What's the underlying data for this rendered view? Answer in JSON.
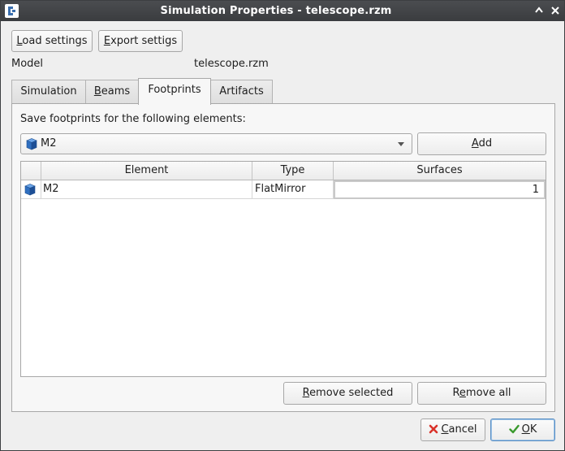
{
  "window": {
    "title": "Simulation Properties - telescope.rzm",
    "restore_glyph": "🡩",
    "close_glyph": "✕"
  },
  "toolbar": {
    "load_settings": {
      "pre": "",
      "mnemonic": "L",
      "post": "oad settings"
    },
    "export_settings": {
      "pre": "",
      "mnemonic": "E",
      "post": "xport settigs"
    }
  },
  "model": {
    "label": "Model",
    "value": "telescope.rzm"
  },
  "tabs": [
    {
      "label": "Simulation",
      "mnemonic_index": -1,
      "active": false
    },
    {
      "pre": "",
      "mnemonic": "B",
      "post": "eams",
      "active": false
    },
    {
      "label": "Footprints",
      "active": true
    },
    {
      "label": "Artifacts",
      "active": false
    }
  ],
  "footprints": {
    "heading": "Save footprints for the following elements:",
    "selected_element": "M2",
    "add_button": {
      "pre": "",
      "mnemonic": "A",
      "post": "dd"
    },
    "table": {
      "headers": [
        "",
        "Element",
        "Type",
        "Surfaces"
      ],
      "rows": [
        {
          "icon": "cube-icon",
          "element": "M2",
          "type": "FlatMirror",
          "surfaces": "1"
        }
      ]
    },
    "remove_selected": {
      "pre": "",
      "mnemonic": "R",
      "post": "emove selected"
    },
    "remove_all": {
      "pre": "R",
      "mnemonic": "e",
      "post": "move all"
    }
  },
  "dialog_buttons": {
    "cancel": {
      "pre": "",
      "mnemonic": "C",
      "post": "ancel"
    },
    "ok": {
      "pre": "",
      "mnemonic": "O",
      "post": "K"
    }
  },
  "colors": {
    "titlebar": "#3f4144",
    "background": "#efefef",
    "panel": "#f7f7f7",
    "cancel_icon": "#d9322a",
    "ok_icon": "#3a9a2e",
    "cube": "#2f6fc0"
  }
}
